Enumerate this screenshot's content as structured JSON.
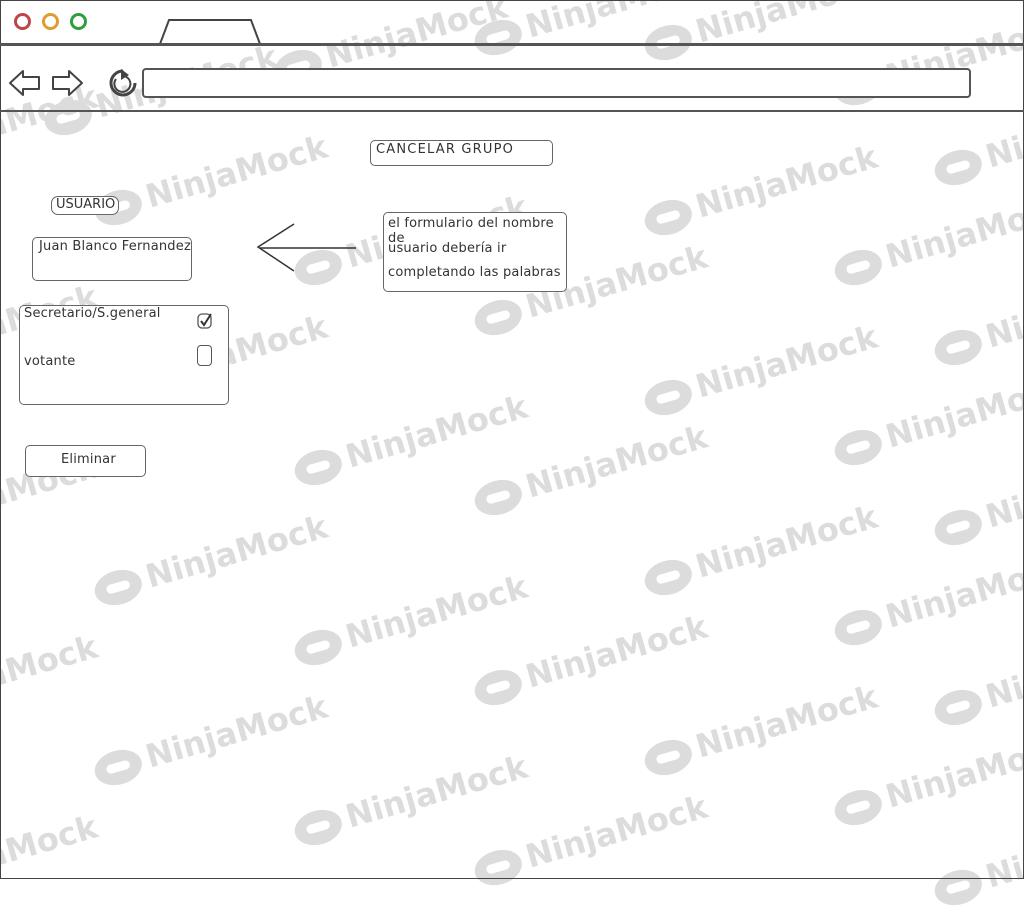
{
  "browser": {
    "traffic_lights": [
      "#c0454a",
      "#e09c2e",
      "#2e9e3e"
    ],
    "back_icon": "back-arrow-icon",
    "forward_icon": "forward-arrow-icon",
    "reload_icon": "reload-icon",
    "url": ""
  },
  "page": {
    "title": "CANCELAR GRUPO",
    "user_label": "USUARIO",
    "user_input_value": "Juan Blanco Fernandez",
    "annotation": "el formulario del nombre de usuario debería ir completando las palabras",
    "annotation_lines": [
      "el formulario del nombre de",
      "usuario debería ir",
      "completando las palabras"
    ],
    "roles": [
      {
        "label": "Secretario/S.general",
        "checked": true
      },
      {
        "label": "votante",
        "checked": false
      }
    ],
    "delete_button": "Eliminar"
  },
  "watermark": "NinjaMock"
}
